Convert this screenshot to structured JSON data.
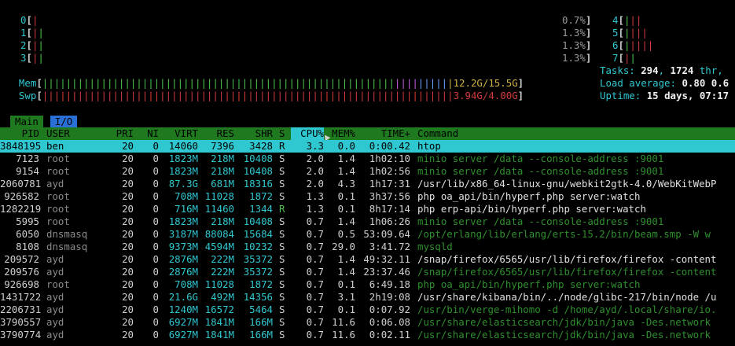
{
  "cpus_left": [
    {
      "label": "0",
      "pct": "0.7%"
    },
    {
      "label": "1",
      "pct": "1.3%"
    },
    {
      "label": "2",
      "pct": "1.3%"
    },
    {
      "label": "3",
      "pct": "1.3%"
    }
  ],
  "cpus_right": [
    {
      "label": "4"
    },
    {
      "label": "5"
    },
    {
      "label": "6"
    },
    {
      "label": "7"
    }
  ],
  "mem": {
    "label": "Mem",
    "value": "12.2G/15.5G"
  },
  "swp": {
    "label": "Swp",
    "value": "3.94G/4.00G"
  },
  "tasks": {
    "prefix": "Tasks: ",
    "count": "294",
    "sep": ", ",
    "threads": "1724",
    "suffix": " thr,"
  },
  "load": {
    "prefix": "Load average: ",
    "value": "0.80 0.6"
  },
  "uptime": {
    "prefix": "Uptime: ",
    "value": "15 days, 07:17"
  },
  "tabs": [
    {
      "label": "Main"
    },
    {
      "label": "I/O"
    }
  ],
  "header": {
    "pid": "PID",
    "user": "USER",
    "pri": "PRI",
    "ni": "NI",
    "virt": "VIRT",
    "res": "RES",
    "shr": "SHR",
    "s": "S",
    "cpu": "CPU%",
    "mem": "MEM%",
    "time": "TIME+",
    "command": "Command"
  },
  "processes": [
    {
      "pid": "3848195",
      "user": "ben",
      "pri": "20",
      "ni": "0",
      "virt": "14060",
      "res": "7396",
      "shr": "3428",
      "s": "R",
      "cpu": "3.3",
      "mem": "0.0",
      "time": "0:00.42",
      "command": "htop",
      "selected": true,
      "thread": false
    },
    {
      "pid": "7123",
      "user": "root",
      "pri": "20",
      "ni": "0",
      "virt": "1823M",
      "res": "218M",
      "shr": "10408",
      "s": "S",
      "cpu": "2.0",
      "mem": "1.4",
      "time": "1h02:10",
      "command": "minio server /data --console-address :9001",
      "thread": true
    },
    {
      "pid": "9154",
      "user": "root",
      "pri": "20",
      "ni": "0",
      "virt": "1823M",
      "res": "218M",
      "shr": "10408",
      "s": "S",
      "cpu": "2.0",
      "mem": "1.4",
      "time": "1h02:56",
      "command": "minio server /data --console-address :9001",
      "thread": true
    },
    {
      "pid": "2060781",
      "user": "ayd",
      "pri": "20",
      "ni": "0",
      "virt": "87.3G",
      "res": "681M",
      "shr": "18316",
      "s": "S",
      "cpu": "2.0",
      "mem": "4.3",
      "time": "1h17:31",
      "command": "/usr/lib/x86_64-linux-gnu/webkit2gtk-4.0/WebKitWebP",
      "thread": false
    },
    {
      "pid": "926582",
      "user": "root",
      "pri": "20",
      "ni": "0",
      "virt": "708M",
      "res": "11028",
      "shr": "1872",
      "s": "S",
      "cpu": "1.3",
      "mem": "0.1",
      "time": "3h37:56",
      "command": "php oa_api/bin/hyperf.php server:watch",
      "thread": false
    },
    {
      "pid": "1282219",
      "user": "root",
      "pri": "20",
      "ni": "0",
      "virt": "716M",
      "res": "11460",
      "shr": "1344",
      "s": "R",
      "cpu": "1.3",
      "mem": "0.1",
      "time": "8h17:14",
      "command": "php erp-api/bin/hyperf.php server:watch",
      "thread": false
    },
    {
      "pid": "5995",
      "user": "root",
      "pri": "20",
      "ni": "0",
      "virt": "1823M",
      "res": "218M",
      "shr": "10408",
      "s": "S",
      "cpu": "0.7",
      "mem": "1.4",
      "time": "1h06:26",
      "command": "minio server /data --console-address :9001",
      "thread": true
    },
    {
      "pid": "6050",
      "user": "dnsmasq",
      "pri": "20",
      "ni": "0",
      "virt": "3187M",
      "res": "88084",
      "shr": "15684",
      "s": "S",
      "cpu": "0.7",
      "mem": "0.5",
      "time": "53:09.64",
      "command": "/opt/erlang/lib/erlang/erts-15.2/bin/beam.smp -W w",
      "thread": true
    },
    {
      "pid": "8108",
      "user": "dnsmasq",
      "pri": "20",
      "ni": "0",
      "virt": "9373M",
      "res": "4594M",
      "shr": "10232",
      "s": "S",
      "cpu": "0.7",
      "mem": "29.0",
      "time": "3:41.72",
      "command": "mysqld",
      "thread": true
    },
    {
      "pid": "209572",
      "user": "ayd",
      "pri": "20",
      "ni": "0",
      "virt": "2876M",
      "res": "222M",
      "shr": "35372",
      "s": "S",
      "cpu": "0.7",
      "mem": "1.4",
      "time": "49:32.11",
      "command": "/snap/firefox/6565/usr/lib/firefox/firefox -content",
      "thread": false
    },
    {
      "pid": "209576",
      "user": "ayd",
      "pri": "20",
      "ni": "0",
      "virt": "2876M",
      "res": "222M",
      "shr": "35372",
      "s": "S",
      "cpu": "0.7",
      "mem": "1.4",
      "time": "23:37.46",
      "command": "/snap/firefox/6565/usr/lib/firefox/firefox -content",
      "thread": true
    },
    {
      "pid": "926698",
      "user": "root",
      "pri": "20",
      "ni": "0",
      "virt": "708M",
      "res": "11028",
      "shr": "1872",
      "s": "S",
      "cpu": "0.7",
      "mem": "0.1",
      "time": "6:49.18",
      "command": "php oa_api/bin/hyperf.php server:watch",
      "thread": true
    },
    {
      "pid": "1431722",
      "user": "ayd",
      "pri": "20",
      "ni": "0",
      "virt": "21.6G",
      "res": "492M",
      "shr": "14356",
      "s": "S",
      "cpu": "0.7",
      "mem": "3.1",
      "time": "2h19:08",
      "command": "/usr/share/kibana/bin/../node/glibc-217/bin/node /u",
      "thread": false
    },
    {
      "pid": "2206731",
      "user": "ayd",
      "pri": "20",
      "ni": "0",
      "virt": "1240M",
      "res": "16572",
      "shr": "5464",
      "s": "S",
      "cpu": "0.7",
      "mem": "0.1",
      "time": "0:07.92",
      "command": "/usr/bin/verge-mihomo -d /home/ayd/.local/share/io.",
      "thread": true
    },
    {
      "pid": "3790557",
      "user": "ayd",
      "pri": "20",
      "ni": "0",
      "virt": "6927M",
      "res": "1841M",
      "shr": "166M",
      "s": "S",
      "cpu": "0.7",
      "mem": "11.6",
      "time": "0:06.08",
      "command": "/usr/share/elasticsearch/jdk/bin/java -Des.network",
      "thread": true
    },
    {
      "pid": "3790774",
      "user": "ayd",
      "pri": "20",
      "ni": "0",
      "virt": "6927M",
      "res": "1841M",
      "shr": "166M",
      "s": "S",
      "cpu": "0.7",
      "mem": "11.6",
      "time": "0:02.11",
      "command": "/usr/share/elasticsearch/jdk/bin/java -Des.network",
      "thread": true
    }
  ]
}
